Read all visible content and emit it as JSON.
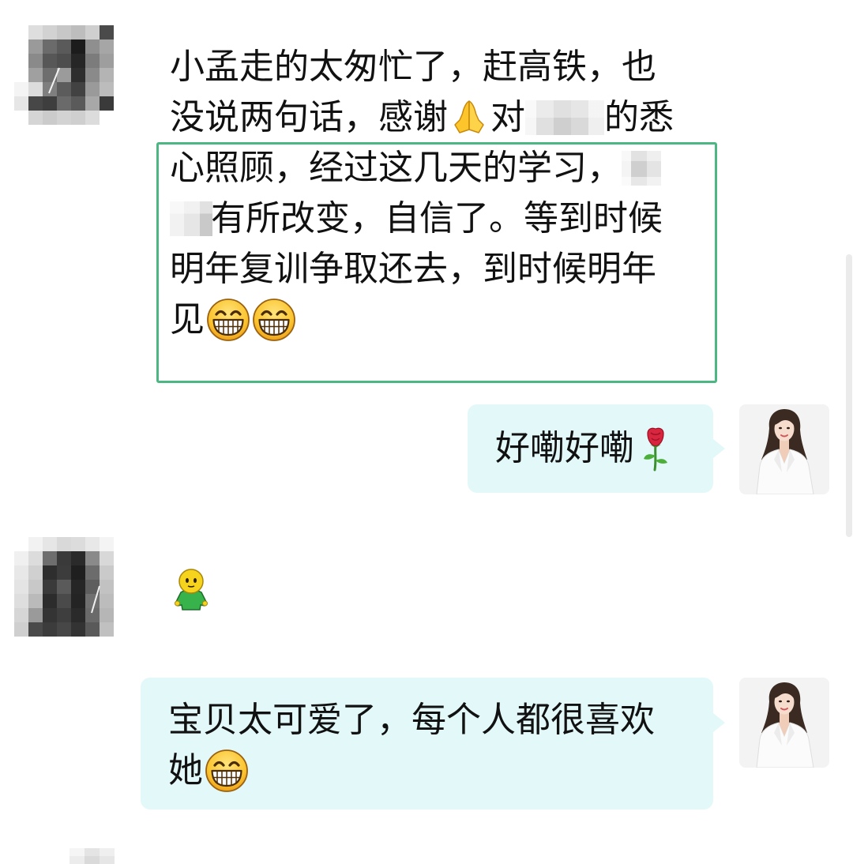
{
  "theme": {
    "page_background": "#ffffff",
    "text_color": "#111111",
    "outgoing_bubble": "#e3f8f8",
    "highlight_border": "#4cb782",
    "scrollbar": "#ebebeb"
  },
  "messages": [
    {
      "direction": "incoming",
      "avatar": "pixelated-avatar",
      "highlighted": true,
      "lines": [
        [
          "小孟走的太匆忙了，赶高铁，也"
        ],
        [
          "没说两句话，感谢",
          "对",
          "的悉"
        ],
        [
          "心照顾，经过这几天的学习，"
        ],
        [
          "有所改变，自信了。等到时候"
        ],
        [
          "明年复训争取还去，到时候明年"
        ],
        [
          "见"
        ]
      ],
      "emoji": [
        "folded-hands-icon",
        "grinning-face-icon",
        "grinning-face-icon"
      ]
    },
    {
      "direction": "outgoing",
      "avatar": "profile-photo",
      "lines": [
        [
          "好嘞好嘞"
        ]
      ],
      "emoji": [
        "rose-icon"
      ]
    },
    {
      "direction": "incoming",
      "avatar": "pixelated-avatar",
      "sticker": "green-figure-sticker-icon"
    },
    {
      "direction": "outgoing",
      "avatar": "profile-photo",
      "lines": [
        [
          "宝贝太可爱了，每个人都很喜欢"
        ],
        [
          "她"
        ]
      ],
      "emoji": [
        "grinning-face-icon"
      ]
    },
    {
      "direction": "incoming",
      "avatar": "pixelated-avatar"
    }
  ]
}
